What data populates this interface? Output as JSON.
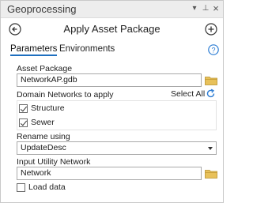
{
  "pane": {
    "title": "Geoprocessing",
    "controls": {
      "menu": "▾",
      "pin": "⊥",
      "close": "×"
    }
  },
  "header": {
    "tool_title": "Apply Asset Package"
  },
  "tabs": [
    {
      "label": "Parameters",
      "active": true
    },
    {
      "label": "Environments",
      "active": false
    }
  ],
  "form": {
    "asset_package": {
      "label": "Asset Package",
      "value": "NetworkAP.gdb"
    },
    "domain_networks": {
      "label": "Domain Networks to apply",
      "select_all_label": "Select All",
      "items": [
        {
          "label": "Structure",
          "checked": true
        },
        {
          "label": "Sewer",
          "checked": true
        }
      ]
    },
    "rename_using": {
      "label": "Rename using",
      "value": "UpdateDesc"
    },
    "input_utility_network": {
      "label": "Input Utility Network",
      "value": "Network"
    },
    "load_data": {
      "label": "Load data",
      "checked": false
    }
  },
  "colors": {
    "accent": "#1e6fbf",
    "folder": "#e0b040",
    "help": "#2b7cd3"
  },
  "icons": [
    "back-arrow-icon",
    "add-icon",
    "help-icon",
    "folder-icon",
    "refresh-icon",
    "chevron-down-icon"
  ]
}
